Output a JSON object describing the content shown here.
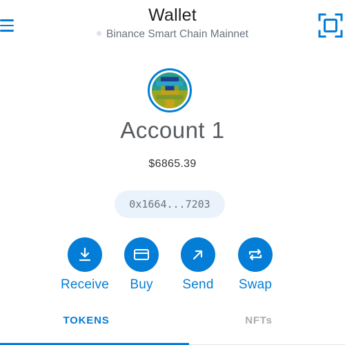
{
  "header": {
    "title": "Wallet",
    "network": "Binance Smart Chain Mainnet",
    "menu_icon": "hamburger-menu-icon",
    "scan_icon": "qr-scan-icon"
  },
  "account": {
    "avatar": "pixel-identicon-avatar",
    "name": "Account 1",
    "balance": "$6865.39",
    "address_short": "0x1664...7203"
  },
  "actions": [
    {
      "label": "Receive",
      "icon": "download-arrow-icon"
    },
    {
      "label": "Buy",
      "icon": "credit-card-icon"
    },
    {
      "label": "Send",
      "icon": "arrow-up-right-icon"
    },
    {
      "label": "Swap",
      "icon": "swap-arrows-icon"
    }
  ],
  "tabs": [
    {
      "label": "TOKENS",
      "active": true
    },
    {
      "label": "NFTs",
      "active": false
    }
  ],
  "colors": {
    "accent": "#037dd6",
    "address_pill_bg": "#eaf3fc",
    "muted_text": "#6a737d",
    "inactive_tab": "#a7adb3"
  }
}
